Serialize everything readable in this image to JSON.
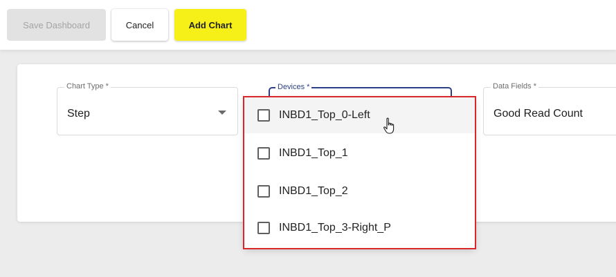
{
  "toolbar": {
    "save_label": "Save Dashboard",
    "cancel_label": "Cancel",
    "add_chart_label": "Add Chart"
  },
  "form": {
    "chart_type": {
      "label": "Chart Type *",
      "value": "Step"
    },
    "devices": {
      "label": "Devices *",
      "options": [
        {
          "label": "INBD1_Top_0-Left",
          "checked": false,
          "hovered": true
        },
        {
          "label": "INBD1_Top_1",
          "checked": false
        },
        {
          "label": "INBD1_Top_2",
          "checked": false
        },
        {
          "label": "INBD1_Top_3-Right_P",
          "checked": false
        }
      ]
    },
    "data_fields": {
      "label": "Data Fields *",
      "value": "Good Read Count"
    }
  },
  "colors": {
    "add_chart_accent": "#f6ef18",
    "focus_outline": "#2b3f86",
    "highlight_box": "#d9262b"
  },
  "icons": {
    "dropdown": "triangle-down",
    "checkbox": "empty-square",
    "cursor": "hand-pointer"
  }
}
